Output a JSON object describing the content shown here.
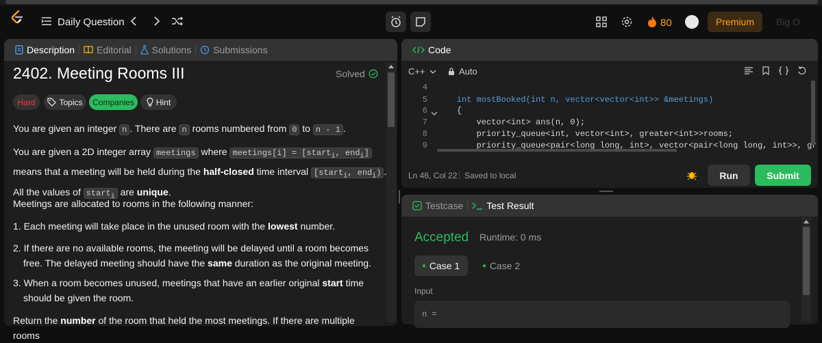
{
  "nav": {
    "list_label": "Daily Question",
    "streak_count": "80",
    "premium_label": "Premium",
    "cut_label": "Big O"
  },
  "left_tabs": {
    "description": "Description",
    "editorial": "Editorial",
    "solutions": "Solutions",
    "submissions": "Submissions"
  },
  "problem": {
    "title": "2402. Meeting Rooms III",
    "status": "Solved",
    "difficulty": "Hard",
    "topics": "Topics",
    "companies": "Companies",
    "hint": "Hint",
    "p1": {
      "a": "You are given an integer ",
      "n1": "n",
      "b": ". There are ",
      "n2": "n",
      "c": " rooms numbered from ",
      "z": "0",
      "d": " to ",
      "nm1": "n - 1",
      "e": "."
    },
    "p2": {
      "a": "You are given a 2D integer array ",
      "meetings": "meetings",
      "b": " where ",
      "mi": "meetings[i] = [start",
      "mi_sub1": "i",
      "mi_mid": ", end",
      "mi_sub2": "i",
      "mi_end": "]",
      "c": "means that a meeting will be held during the ",
      "half": "half-closed",
      "d": " time interval ",
      "iv": "[start",
      "iv_sub1": "i",
      "iv_mid": ", end",
      "iv_sub2": "i",
      "iv_end": ")",
      "e": ".",
      "f": "All the values of ",
      "st": "start",
      "st_sub": "i",
      "g": " are ",
      "unique": "unique",
      "h": "."
    },
    "p3": "Meetings are allocated to rooms in the following manner:",
    "li1": {
      "a": "1. Each meeting will take place in the unused room with the ",
      "b": "lowest",
      "c": " number."
    },
    "li2": {
      "a": "2. If there are no available rooms, the meeting will be delayed until a room becomes",
      "b": "free. The delayed meeting should have the ",
      "c": "same",
      "d": " duration as the original meeting."
    },
    "li3": {
      "a": "3. When a room becomes unused, meetings that have an earlier original ",
      "b": "start",
      "c": " time",
      "d": "should be given the room."
    },
    "p4": {
      "a": "Return the ",
      "b": "number",
      "c": " of the room that held the most meetings. If there are multiple rooms"
    }
  },
  "code_panel": {
    "title": "Code",
    "language": "C++",
    "auto": "Auto",
    "lines": [
      {
        "num": "4",
        "text": ""
      },
      {
        "num": "5",
        "text": "    int mostBooked(int n, vector<vector<int>> &meetings)"
      },
      {
        "num": "6",
        "text": "    {"
      },
      {
        "num": "7",
        "text": "        vector<int> ans(n, 0);"
      },
      {
        "num": "8",
        "text": "        priority_queue<int, vector<int>, greater<int>>rooms;"
      },
      {
        "num": "9",
        "text": "        priority_queue<pair<long long, int>, vector<pair<long long, int>>, greate"
      }
    ],
    "position": "Ln 46, Col 22",
    "saved": "Saved to local",
    "run": "Run",
    "submit": "Submit"
  },
  "result_panel": {
    "testcase_tab": "Testcase",
    "result_tab": "Test Result",
    "verdict": "Accepted",
    "runtime": "Runtime: 0 ms",
    "case1": "Case 1",
    "case2": "Case 2",
    "input_label": "Input",
    "input_value": "n ="
  },
  "colors": {
    "accent_green": "#2cbb5d",
    "hard_red": "#f63636",
    "premium_orange": "#ffa116",
    "flame": "#ff7a00"
  }
}
